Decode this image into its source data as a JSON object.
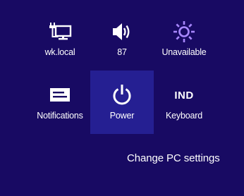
{
  "panel": {
    "accent_color": "#a887ff",
    "background_color": "#180a63",
    "selected_tile_color": "#251f92"
  },
  "tiles": [
    {
      "id": "network",
      "label": "wk.local",
      "icon": "network-wired-icon"
    },
    {
      "id": "volume",
      "label": "87",
      "icon": "speaker-volume-icon"
    },
    {
      "id": "brightness",
      "label": "Unavailable",
      "icon": "brightness-sun-icon"
    },
    {
      "id": "notifications",
      "label": "Notifications",
      "icon": "message-notification-icon"
    },
    {
      "id": "power",
      "label": "Power",
      "icon": "power-icon",
      "selected": true
    },
    {
      "id": "keyboard",
      "label": "Keyboard",
      "icon_text": "IND"
    }
  ],
  "footer": {
    "change_pc_settings": "Change PC settings"
  }
}
